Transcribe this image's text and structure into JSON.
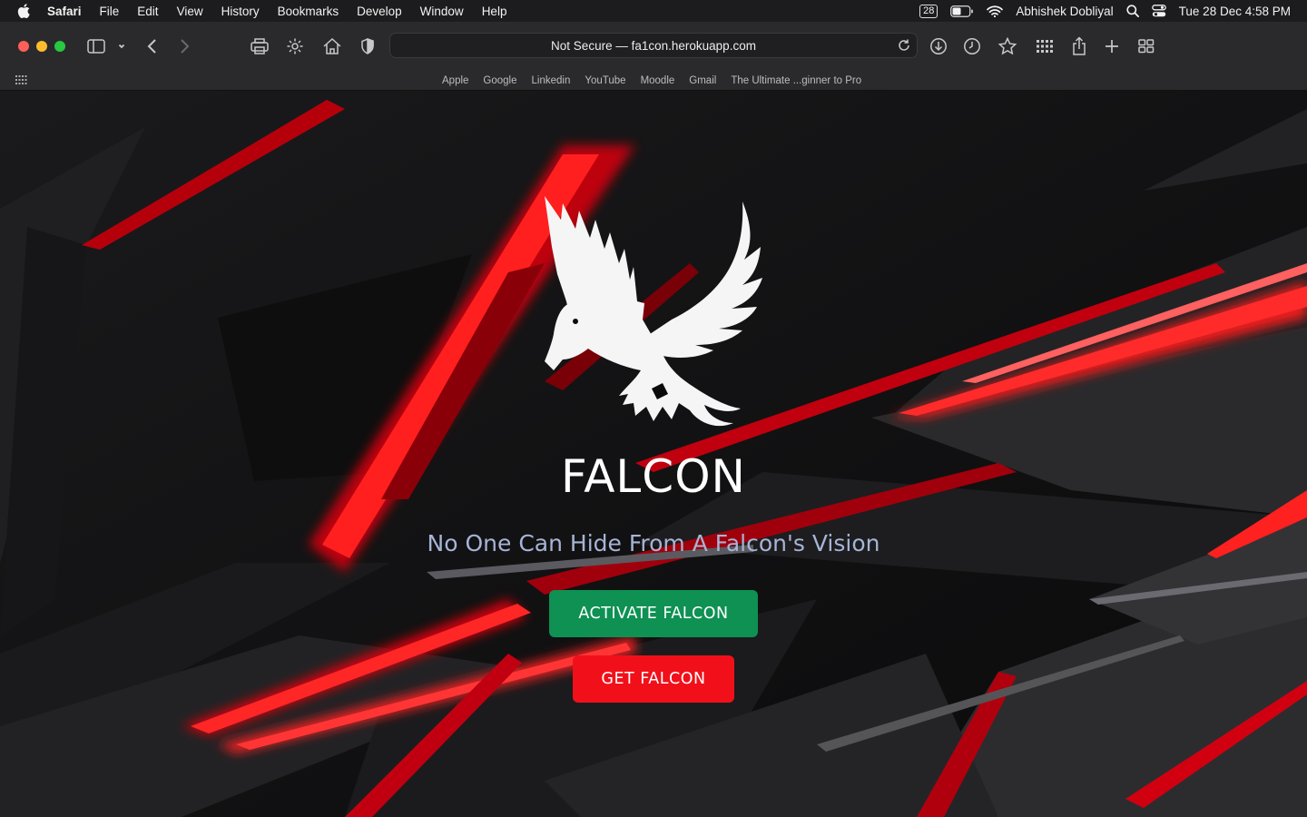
{
  "menubar": {
    "app_name": "Safari",
    "items": [
      "File",
      "Edit",
      "View",
      "History",
      "Bookmarks",
      "Develop",
      "Window",
      "Help"
    ],
    "status": {
      "badge": "28",
      "user": "Abhishek Dobliyal",
      "datetime": "Tue 28 Dec  4:58 PM"
    }
  },
  "toolbar": {
    "address": {
      "security_label": "Not Secure —",
      "domain": "fa1con.herokuapp.com"
    }
  },
  "favorites": [
    "Apple",
    "Google",
    "Linkedin",
    "YouTube",
    "Moodle",
    "Gmail",
    "The Ultimate ...ginner to Pro"
  ],
  "page": {
    "brand": "FALCON",
    "tagline": "No One Can Hide From A Falcon's Vision",
    "buttons": {
      "activate": "ACTIVATE FALCON",
      "get": "GET FALCON"
    }
  },
  "colors": {
    "activate_button": "#0e9153",
    "get_button": "#f1101a",
    "tagline": "#a7b4d6",
    "accent_red": "#ff1a1a"
  },
  "icons": [
    "apple-icon",
    "battery-icon",
    "wifi-icon",
    "search-icon",
    "control-center-icon",
    "sidebar-icon",
    "back-icon",
    "forward-icon",
    "print-icon",
    "settings-icon",
    "home-icon",
    "shield-icon",
    "reload-icon",
    "downloads-icon",
    "history-icon",
    "bookmark-star-icon",
    "apps-grid-icon",
    "share-icon",
    "new-tab-icon",
    "tab-overview-icon",
    "falcon-logo"
  ]
}
